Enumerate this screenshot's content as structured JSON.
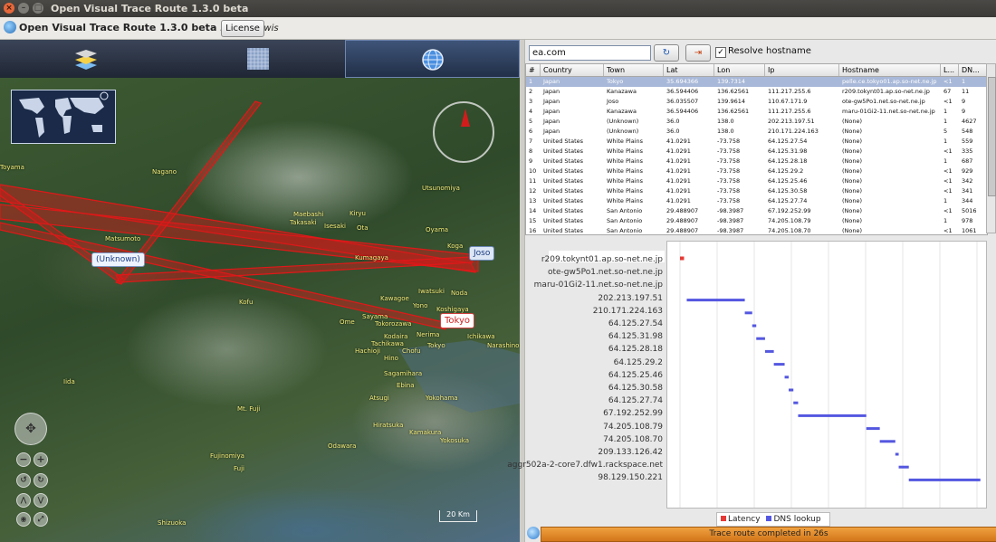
{
  "window": {
    "title": "Open Visual Trace Route 1.3.0 beta",
    "close": "×",
    "minimize": "–",
    "maximize": "□"
  },
  "app": {
    "title": "Open Visual Trace Route 1.3.0 beta",
    "byline": "by Leo Lewis",
    "license": "License"
  },
  "map": {
    "pins": [
      "(Unknown)",
      "Joso",
      "Tokyo"
    ],
    "labels": [
      "Toyama",
      "Nagano",
      "Utsunomiya",
      "Maebashi",
      "Takasaki",
      "Isesaki",
      "Ota",
      "Oyama",
      "Kiryu",
      "Koga",
      "Matsumoto",
      "Kumagaya",
      "Kawagoe",
      "Iwatsuki",
      "Noda",
      "Yono",
      "Koshigaya",
      "Ome",
      "Sayama",
      "Tokorozawa",
      "Nerima",
      "Ichikawa",
      "Narashino",
      "Hachioji",
      "Tachikawa",
      "Chofu",
      "Kodaira",
      "Sagamihara",
      "Atsugi",
      "Ebina",
      "Yokohama",
      "Hiratsuka",
      "Odawara",
      "Kamakura",
      "Yokosuka",
      "Mt. Fuji",
      "Iida",
      "Fujinomiya",
      "Fuji",
      "Shizuoka",
      "Kofu",
      "Hino",
      "Tokyo"
    ],
    "scale": "20 Km"
  },
  "toolbar": {
    "search_value": "ea.com",
    "resolve_label": "Resolve hostname",
    "resolve_checked": "✓",
    "go_icon": "↻",
    "exit_icon": "⇥"
  },
  "table": {
    "headers": [
      "#",
      "Country",
      "Town",
      "Lat",
      "Lon",
      "Ip",
      "Hostname",
      "L...",
      "DN..."
    ],
    "rows": [
      [
        "1",
        "Japan",
        "Tokyo",
        "35.694366",
        "139.7314",
        "",
        "pelle.ce.tokyo01.ap.so-net.ne.jp",
        "<1",
        "1"
      ],
      [
        "2",
        "Japan",
        "Kanazawa",
        "36.594406",
        "136.62561",
        "111.217.255.6",
        "r209.tokynt01.ap.so-net.ne.jp",
        "67",
        "11"
      ],
      [
        "3",
        "Japan",
        "Joso",
        "36.035507",
        "139.9614",
        "110.67.171.9",
        "ote-gw5Po1.net.so-net.ne.jp",
        "<1",
        "9"
      ],
      [
        "4",
        "Japan",
        "Kanazawa",
        "36.594406",
        "136.62561",
        "111.217.255.6",
        "maru-01Gi2-11.net.so-net.ne.jp",
        "1",
        "9"
      ],
      [
        "5",
        "Japan",
        "(Unknown)",
        "36.0",
        "138.0",
        "202.213.197.51",
        "(None)",
        "1",
        "4627"
      ],
      [
        "6",
        "Japan",
        "(Unknown)",
        "36.0",
        "138.0",
        "210.171.224.163",
        "(None)",
        "5",
        "548"
      ],
      [
        "7",
        "United States",
        "White Plains",
        "41.0291",
        "-73.758",
        "64.125.27.54",
        "(None)",
        "1",
        "559"
      ],
      [
        "8",
        "United States",
        "White Plains",
        "41.0291",
        "-73.758",
        "64.125.31.98",
        "(None)",
        "<1",
        "335"
      ],
      [
        "9",
        "United States",
        "White Plains",
        "41.0291",
        "-73.758",
        "64.125.28.18",
        "(None)",
        "1",
        "687"
      ],
      [
        "10",
        "United States",
        "White Plains",
        "41.0291",
        "-73.758",
        "64.125.29.2",
        "(None)",
        "<1",
        "929"
      ],
      [
        "11",
        "United States",
        "White Plains",
        "41.0291",
        "-73.758",
        "64.125.25.46",
        "(None)",
        "<1",
        "342"
      ],
      [
        "12",
        "United States",
        "White Plains",
        "41.0291",
        "-73.758",
        "64.125.30.58",
        "(None)",
        "<1",
        "341"
      ],
      [
        "13",
        "United States",
        "White Plains",
        "41.0291",
        "-73.758",
        "64.125.27.74",
        "(None)",
        "1",
        "344"
      ],
      [
        "14",
        "United States",
        "San Antonio",
        "29.488907",
        "-98.3987",
        "67.192.252.99",
        "(None)",
        "<1",
        "5016"
      ],
      [
        "15",
        "United States",
        "San Antonio",
        "29.488907",
        "-98.3987",
        "74.205.108.79",
        "(None)",
        "1",
        "978"
      ],
      [
        "16",
        "United States",
        "San Antonio",
        "29.488907",
        "-98.3987",
        "74.205.108.70",
        "(None)",
        "<1",
        "1061"
      ]
    ]
  },
  "chart_data": {
    "type": "bar",
    "categories": [
      "r209.tokynt01.ap.so-net.ne.jp",
      "ote-gw5Po1.net.so-net.ne.jp",
      "maru-01Gi2-11.net.so-net.ne.jp",
      "202.213.197.51",
      "210.171.224.163",
      "64.125.27.54",
      "64.125.31.98",
      "64.125.28.18",
      "64.125.29.2",
      "64.125.25.46",
      "64.125.30.58",
      "64.125.27.74",
      "67.192.252.99",
      "74.205.108.79",
      "74.205.108.70",
      "209.133.126.42",
      "aggr502a-2-core7.dfw1.rackspace.net",
      "98.129.150.221"
    ],
    "series": [
      {
        "name": "Latency",
        "color": "#e53935",
        "start": [
          0,
          0.1,
          0.1,
          0.1,
          0.1,
          0.1,
          0.1,
          0.1,
          0.1,
          0.1,
          0.1,
          0.1,
          0.1,
          0.1,
          0.1,
          0.1,
          0.1,
          0.1
        ],
        "values": [
          0.6,
          0,
          0,
          0,
          0,
          0,
          0,
          0,
          0,
          0,
          0,
          0,
          0,
          0,
          0,
          0,
          0,
          0
        ]
      },
      {
        "name": "DNS lookup",
        "color": "#5457e0",
        "start": [
          0,
          0,
          0,
          1,
          9.6,
          10.7,
          11.3,
          12.6,
          13.9,
          15.5,
          16.1,
          16.8,
          17.5,
          27.6,
          29.6,
          31.9,
          32.4,
          33.9
        ],
        "values": [
          0,
          0,
          0,
          8.6,
          1.1,
          0.6,
          1.3,
          1.3,
          1.6,
          0.6,
          0.7,
          0.7,
          10.1,
          2,
          2.3,
          0.5,
          1.5,
          10.6
        ]
      }
    ],
    "xlim": [
      0,
      44
    ],
    "legend": "bottom"
  },
  "status": {
    "text": "Trace route completed in 26s"
  },
  "colors": {
    "route": "#e01818",
    "accent": "#d87a1d"
  }
}
